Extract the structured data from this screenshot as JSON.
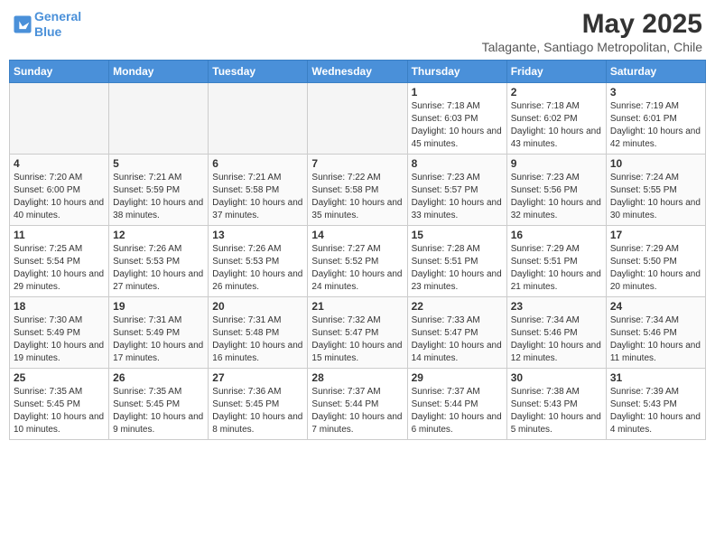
{
  "header": {
    "logo_line1": "General",
    "logo_line2": "Blue",
    "main_title": "May 2025",
    "sub_title": "Talagante, Santiago Metropolitan, Chile"
  },
  "days_of_week": [
    "Sunday",
    "Monday",
    "Tuesday",
    "Wednesday",
    "Thursday",
    "Friday",
    "Saturday"
  ],
  "weeks": [
    [
      {
        "day": "",
        "empty": true
      },
      {
        "day": "",
        "empty": true
      },
      {
        "day": "",
        "empty": true
      },
      {
        "day": "",
        "empty": true
      },
      {
        "day": "1",
        "sunrise": "7:18 AM",
        "sunset": "6:03 PM",
        "daylight": "10 hours and 45 minutes."
      },
      {
        "day": "2",
        "sunrise": "7:18 AM",
        "sunset": "6:02 PM",
        "daylight": "10 hours and 43 minutes."
      },
      {
        "day": "3",
        "sunrise": "7:19 AM",
        "sunset": "6:01 PM",
        "daylight": "10 hours and 42 minutes."
      }
    ],
    [
      {
        "day": "4",
        "sunrise": "7:20 AM",
        "sunset": "6:00 PM",
        "daylight": "10 hours and 40 minutes."
      },
      {
        "day": "5",
        "sunrise": "7:21 AM",
        "sunset": "5:59 PM",
        "daylight": "10 hours and 38 minutes."
      },
      {
        "day": "6",
        "sunrise": "7:21 AM",
        "sunset": "5:58 PM",
        "daylight": "10 hours and 37 minutes."
      },
      {
        "day": "7",
        "sunrise": "7:22 AM",
        "sunset": "5:58 PM",
        "daylight": "10 hours and 35 minutes."
      },
      {
        "day": "8",
        "sunrise": "7:23 AM",
        "sunset": "5:57 PM",
        "daylight": "10 hours and 33 minutes."
      },
      {
        "day": "9",
        "sunrise": "7:23 AM",
        "sunset": "5:56 PM",
        "daylight": "10 hours and 32 minutes."
      },
      {
        "day": "10",
        "sunrise": "7:24 AM",
        "sunset": "5:55 PM",
        "daylight": "10 hours and 30 minutes."
      }
    ],
    [
      {
        "day": "11",
        "sunrise": "7:25 AM",
        "sunset": "5:54 PM",
        "daylight": "10 hours and 29 minutes."
      },
      {
        "day": "12",
        "sunrise": "7:26 AM",
        "sunset": "5:53 PM",
        "daylight": "10 hours and 27 minutes."
      },
      {
        "day": "13",
        "sunrise": "7:26 AM",
        "sunset": "5:53 PM",
        "daylight": "10 hours and 26 minutes."
      },
      {
        "day": "14",
        "sunrise": "7:27 AM",
        "sunset": "5:52 PM",
        "daylight": "10 hours and 24 minutes."
      },
      {
        "day": "15",
        "sunrise": "7:28 AM",
        "sunset": "5:51 PM",
        "daylight": "10 hours and 23 minutes."
      },
      {
        "day": "16",
        "sunrise": "7:29 AM",
        "sunset": "5:51 PM",
        "daylight": "10 hours and 21 minutes."
      },
      {
        "day": "17",
        "sunrise": "7:29 AM",
        "sunset": "5:50 PM",
        "daylight": "10 hours and 20 minutes."
      }
    ],
    [
      {
        "day": "18",
        "sunrise": "7:30 AM",
        "sunset": "5:49 PM",
        "daylight": "10 hours and 19 minutes."
      },
      {
        "day": "19",
        "sunrise": "7:31 AM",
        "sunset": "5:49 PM",
        "daylight": "10 hours and 17 minutes."
      },
      {
        "day": "20",
        "sunrise": "7:31 AM",
        "sunset": "5:48 PM",
        "daylight": "10 hours and 16 minutes."
      },
      {
        "day": "21",
        "sunrise": "7:32 AM",
        "sunset": "5:47 PM",
        "daylight": "10 hours and 15 minutes."
      },
      {
        "day": "22",
        "sunrise": "7:33 AM",
        "sunset": "5:47 PM",
        "daylight": "10 hours and 14 minutes."
      },
      {
        "day": "23",
        "sunrise": "7:34 AM",
        "sunset": "5:46 PM",
        "daylight": "10 hours and 12 minutes."
      },
      {
        "day": "24",
        "sunrise": "7:34 AM",
        "sunset": "5:46 PM",
        "daylight": "10 hours and 11 minutes."
      }
    ],
    [
      {
        "day": "25",
        "sunrise": "7:35 AM",
        "sunset": "5:45 PM",
        "daylight": "10 hours and 10 minutes."
      },
      {
        "day": "26",
        "sunrise": "7:35 AM",
        "sunset": "5:45 PM",
        "daylight": "10 hours and 9 minutes."
      },
      {
        "day": "27",
        "sunrise": "7:36 AM",
        "sunset": "5:45 PM",
        "daylight": "10 hours and 8 minutes."
      },
      {
        "day": "28",
        "sunrise": "7:37 AM",
        "sunset": "5:44 PM",
        "daylight": "10 hours and 7 minutes."
      },
      {
        "day": "29",
        "sunrise": "7:37 AM",
        "sunset": "5:44 PM",
        "daylight": "10 hours and 6 minutes."
      },
      {
        "day": "30",
        "sunrise": "7:38 AM",
        "sunset": "5:43 PM",
        "daylight": "10 hours and 5 minutes."
      },
      {
        "day": "31",
        "sunrise": "7:39 AM",
        "sunset": "5:43 PM",
        "daylight": "10 hours and 4 minutes."
      }
    ]
  ]
}
